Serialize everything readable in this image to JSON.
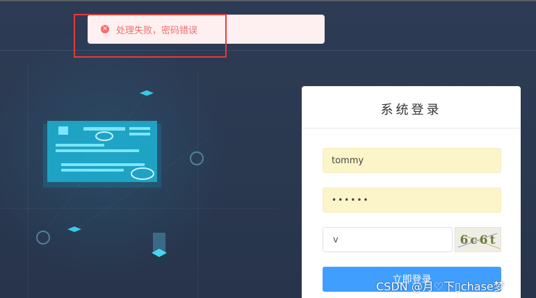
{
  "toast": {
    "icon": "error-circle-icon",
    "message": "处理失败，密码错误",
    "color": "#f56c6c"
  },
  "login": {
    "title": "系统登录",
    "username_value": "tommy",
    "password_value": "••••••",
    "captcha_value": "v",
    "captcha_image_text": "6c6t",
    "submit_label": "立即登录"
  },
  "watermark": "CSDN @月♡下▯chase梦",
  "colors": {
    "accent": "#409eff",
    "background": "#2b3a52",
    "autofill": "#fcf5c9",
    "highlight": "#e53b3b"
  }
}
